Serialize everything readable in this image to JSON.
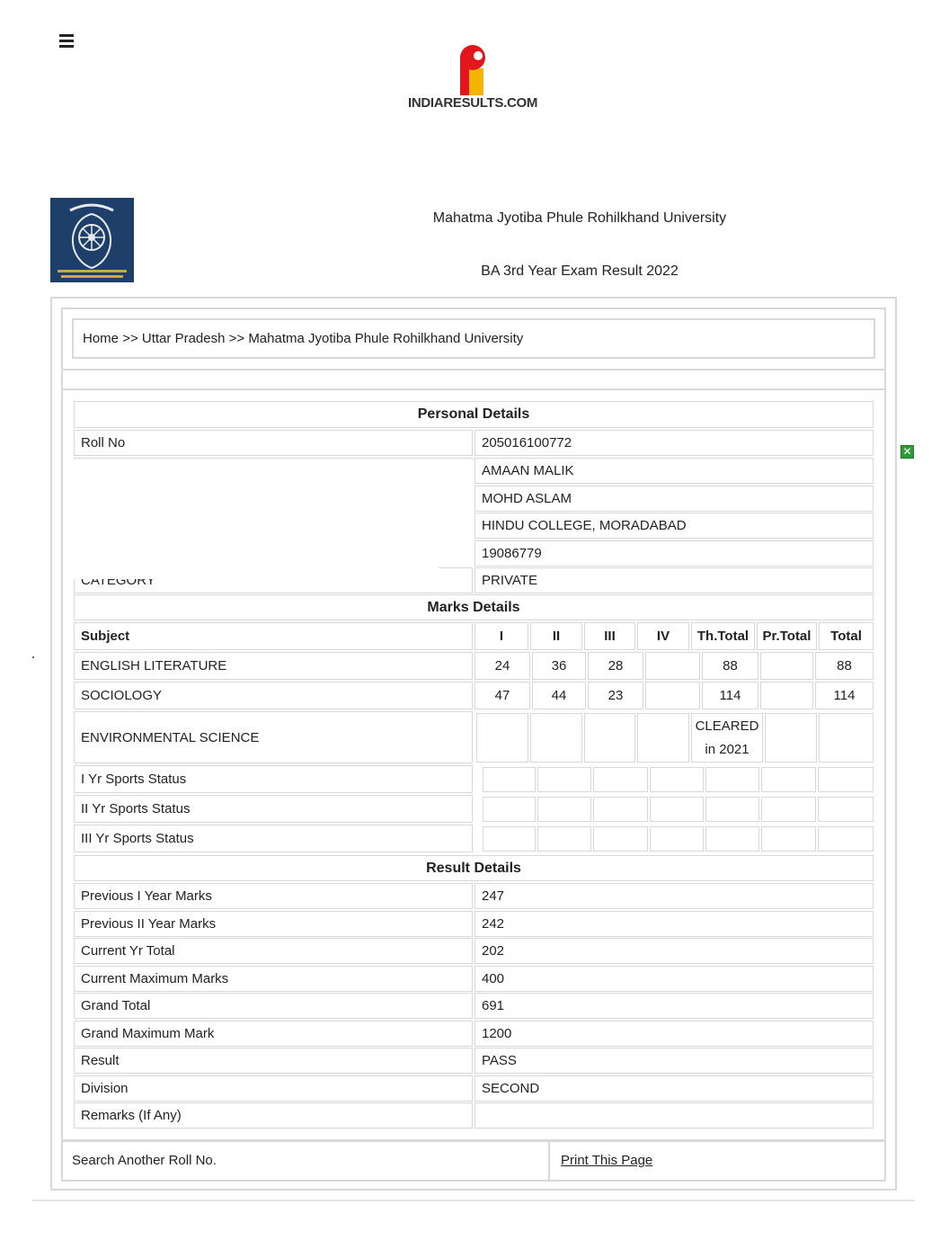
{
  "header": {
    "site_logo_text": "INDIARESULTS.COM"
  },
  "university": {
    "name": "Mahatma Jyotiba Phule Rohilkhand University",
    "exam": "BA 3rd Year Exam Result 2022",
    "logo_text": "महात्मा ज्योतिबा फुले रुहेलखण्ड विश्वविद्यालय"
  },
  "breadcrumb": {
    "home": "Home",
    "sep1": ">>",
    "state": "Uttar Pradesh",
    "sep2": ">>",
    "university": "Mahatma Jyotiba Phule Rohilkhand University"
  },
  "personal": {
    "heading": "Personal Details",
    "roll_label": "Roll No",
    "roll_value": "205016100772",
    "name_value": "AMAAN MALIK",
    "father_value": "MOHD ASLAM",
    "college_value": "HINDU COLLEGE, MORADABAD",
    "enrol_value": "19086779",
    "category_label_partial": "CATEGORY",
    "category_value": "PRIVATE"
  },
  "marks": {
    "heading": "Marks Details",
    "headers": [
      "Subject",
      "I",
      "II",
      "III",
      "IV",
      "Th.Total",
      "Pr.Total",
      "Total"
    ],
    "rows": [
      {
        "subject": "ENGLISH LITERATURE",
        "i": "24",
        "ii": "36",
        "iii": "28",
        "iv": "",
        "th": "88",
        "pr": "",
        "total": "88"
      },
      {
        "subject": "SOCIOLOGY",
        "i": "47",
        "ii": "44",
        "iii": "23",
        "iv": "",
        "th": "114",
        "pr": "",
        "total": "114"
      },
      {
        "subject": "ENVIRONMENTAL SCIENCE",
        "th_line1": "CLEARED",
        "th_line2": "in 2021"
      }
    ],
    "sports": [
      "I Yr Sports Status",
      "II Yr Sports Status",
      "III Yr Sports Status"
    ]
  },
  "result": {
    "heading": "Result Details",
    "rows": [
      {
        "label": "Previous I Year Marks",
        "value": "247"
      },
      {
        "label": "Previous II Year Marks",
        "value": "242"
      },
      {
        "label": "Current Yr Total",
        "value": "202"
      },
      {
        "label": "Current Maximum Marks",
        "value": "400"
      },
      {
        "label": "Grand Total",
        "value": "691"
      },
      {
        "label": "Grand Maximum Mark",
        "value": "1200"
      },
      {
        "label": "Result",
        "value": "PASS"
      },
      {
        "label": "Division",
        "value": "SECOND"
      },
      {
        "label": "Remarks (If Any)",
        "value": ""
      }
    ]
  },
  "footer": {
    "search_again": "Search Another Roll No.",
    "print": "Print This Page"
  },
  "ad": {
    "close_glyph": "✕"
  },
  "colors": {
    "border": "#d8d8d8",
    "logo_red": "#e3161d",
    "logo_yellow": "#f5b400",
    "uni_logo_bg": "#1d3f6a",
    "ad_close_green": "#2e9b3a"
  }
}
